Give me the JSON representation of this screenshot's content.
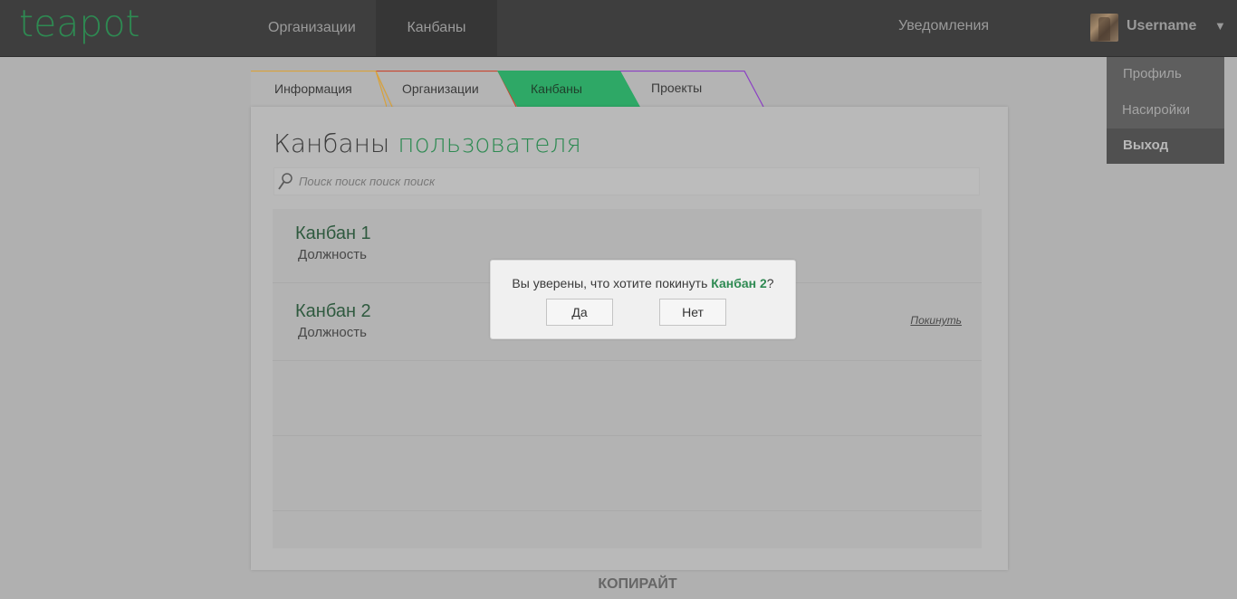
{
  "header": {
    "logo": "teapot",
    "nav": [
      {
        "label": "Организации"
      },
      {
        "label": "Канбаны",
        "active": true
      }
    ],
    "notifications_label": "Уведомления",
    "username": "Username",
    "caret": "▼"
  },
  "user_menu": {
    "items": [
      {
        "label": "Профиль"
      },
      {
        "label": "Насиройки"
      },
      {
        "label": "Выход",
        "active": true
      }
    ]
  },
  "tabs": [
    {
      "label": "Информация",
      "color": "#d9a23b"
    },
    {
      "label": "Организации",
      "color": "#c9452f"
    },
    {
      "label": "Канбаны",
      "color": "#2ea866",
      "active": true
    },
    {
      "label": "Проекты",
      "color": "#8b3fc4"
    }
  ],
  "page": {
    "title_plain": "Канбаны",
    "title_accent": "пользователя",
    "search_placeholder": "Поиск поиск поиск поиск"
  },
  "kanbans": [
    {
      "title": "Канбан 1",
      "subtitle": "Должность",
      "action": ""
    },
    {
      "title": "Канбан 2",
      "subtitle": "Должность",
      "action": "Покинуть"
    }
  ],
  "footer": "КОПИРАЙТ",
  "modal": {
    "message_before": "Вы уверены, что хотите покинуть ",
    "kanban_name": "Канбан 2",
    "message_after": "?",
    "yes_label": "Да",
    "no_label": "Нет"
  },
  "colors": {
    "brand": "#2e8a52",
    "header_bg": "#3e3e3e",
    "overlay": "#b0b0b0"
  }
}
